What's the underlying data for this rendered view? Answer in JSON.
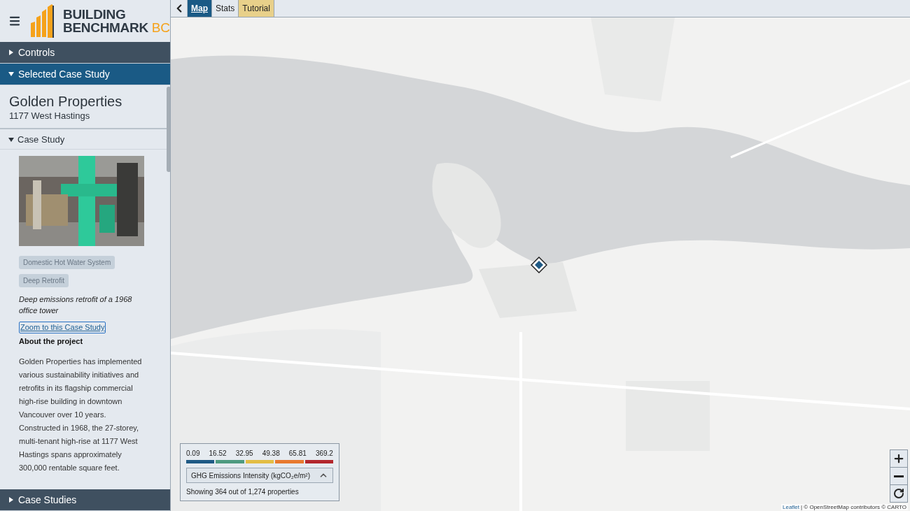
{
  "header": {
    "logo_line_1": "BUILDING",
    "logo_line_2": "BENCHMARK",
    "logo_suffix": "BC"
  },
  "panels": [
    {
      "title": "Controls",
      "expanded": false
    },
    {
      "title": "Selected Case Study",
      "expanded": true
    }
  ],
  "case_study": {
    "name": "Golden Properties",
    "address": "1177 West Hastings",
    "section": {
      "title": "Case Study",
      "expanded": true
    },
    "tags": [
      "Domestic Hot Water System",
      "Deep Retrofit"
    ],
    "summary": "Deep emissions retrofit of a 1968 office tower",
    "zoom_link": "Zoom to this Case Study",
    "about_heading": "About the project",
    "about_text": "Golden Properties has implemented various sustainability initiatives and retrofits in its flagship commercial high-rise building in downtown Vancouver over 10 years. Constructed in 1968, the 27-storey, multi-tenant high-rise at 1177 West Hastings spans approximately 300,000 rentable square feet."
  },
  "footer_panel": {
    "title": "Case Studies",
    "expanded": false
  },
  "tabs": [
    {
      "label": "Map",
      "selected": true,
      "highlighted": false
    },
    {
      "label": "Stats",
      "selected": false,
      "highlighted": false
    },
    {
      "label": "Tutorial",
      "selected": false,
      "highlighted": true
    }
  ],
  "legend": {
    "breaks": [
      "0.09",
      "16.52",
      "32.95",
      "49.38",
      "65.81",
      "369.2"
    ],
    "segments": [
      {
        "color": "#1f5a85"
      },
      {
        "color": "#4e9a80"
      },
      {
        "color": "#e3bd45"
      },
      {
        "color": "#e8792f"
      },
      {
        "color": "#b3272d"
      }
    ],
    "metric": "GHG Emissions Intensity (kgCO₂e/m²)",
    "count": "Showing 364 out of 1,274 properties"
  },
  "attribution": {
    "leaflet": "Leaflet",
    "rest": "| © OpenStreetMap contributors © CARTO"
  }
}
